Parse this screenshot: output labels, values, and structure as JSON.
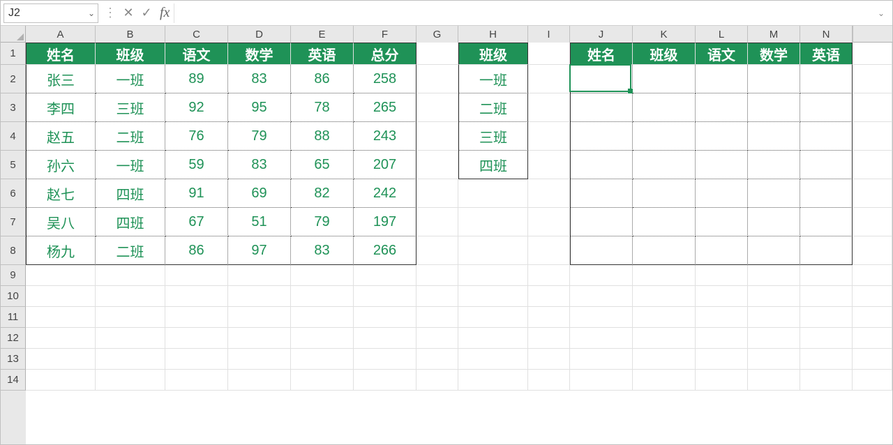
{
  "nameBox": "J2",
  "formula": "",
  "fxLabel": "fx",
  "colWidths": {
    "A": 100,
    "B": 100,
    "C": 90,
    "D": 90,
    "E": 90,
    "F": 90,
    "G": 60,
    "H": 100,
    "I": 60,
    "J": 90,
    "K": 90,
    "L": 75,
    "M": 75,
    "N": 75,
    "O": 20
  },
  "rowHeights": {
    "header": 32,
    "data": 41,
    "default": 30
  },
  "colLetters": [
    "A",
    "B",
    "C",
    "D",
    "E",
    "F",
    "G",
    "H",
    "I",
    "J",
    "K",
    "L",
    "M",
    "N"
  ],
  "rowNumbers": [
    1,
    2,
    3,
    4,
    5,
    6,
    7,
    8,
    9,
    10,
    11,
    12,
    13,
    14
  ],
  "table1": {
    "headers": [
      "姓名",
      "班级",
      "语文",
      "数学",
      "英语",
      "总分"
    ],
    "rows": [
      [
        "张三",
        "一班",
        89,
        83,
        86,
        258
      ],
      [
        "李四",
        "三班",
        92,
        95,
        78,
        265
      ],
      [
        "赵五",
        "二班",
        76,
        79,
        88,
        243
      ],
      [
        "孙六",
        "一班",
        59,
        83,
        65,
        207
      ],
      [
        "赵七",
        "四班",
        91,
        69,
        82,
        242
      ],
      [
        "吴八",
        "四班",
        67,
        51,
        79,
        197
      ],
      [
        "杨九",
        "二班",
        86,
        97,
        83,
        266
      ]
    ]
  },
  "table2": {
    "header": "班级",
    "rows": [
      "一班",
      "二班",
      "三班",
      "四班"
    ]
  },
  "table3": {
    "headers": [
      "姓名",
      "班级",
      "语文",
      "数学",
      "英语"
    ],
    "rowCount": 7
  },
  "activeCell": {
    "col": "J",
    "row": 2
  }
}
